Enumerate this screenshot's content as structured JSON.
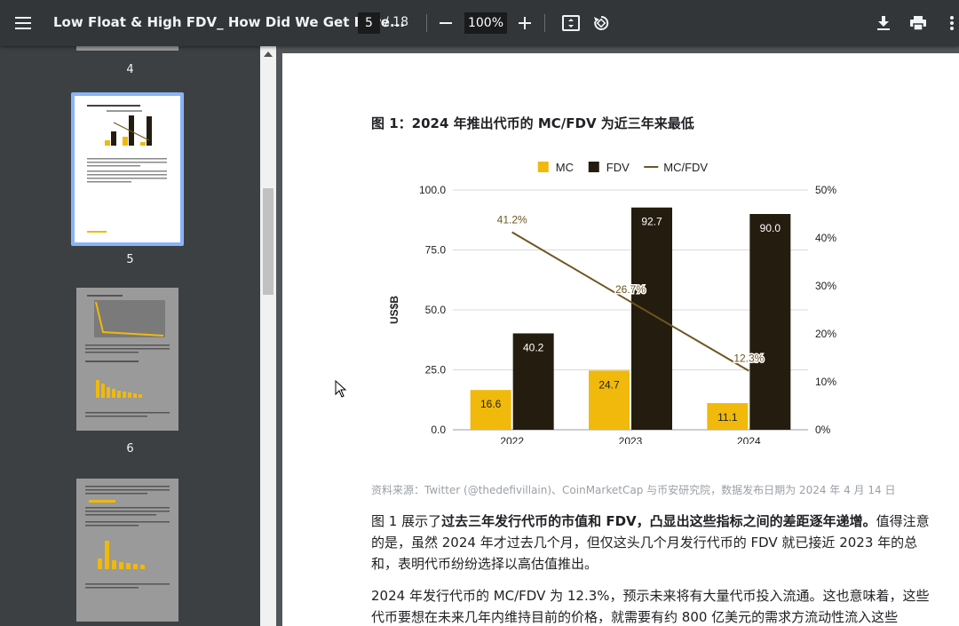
{
  "toolbar": {
    "title": "Low Float & High FDV_ How Did We Get Here...",
    "page_current": "5",
    "page_total": "/ 18",
    "zoom": "100%"
  },
  "sidebar": {
    "labels": [
      "4",
      "5",
      "6"
    ]
  },
  "figure": {
    "title": "图 1：2024 年推出代币的 MC/FDV 为近三年来最低",
    "source": "资料来源：Twitter (@thedefivillain)、CoinMarketCap 与币安研究院，数据发布日期为 2024 年 4 月 14 日"
  },
  "chart_data": {
    "type": "bar",
    "categories": [
      "2022",
      "2023",
      "2024"
    ],
    "series": [
      {
        "name": "MC",
        "values": [
          16.6,
          24.7,
          11.1
        ],
        "color": "#f0b90b",
        "kind": "bar"
      },
      {
        "name": "FDV",
        "values": [
          40.2,
          92.7,
          90.0
        ],
        "color": "#241d0f",
        "kind": "bar"
      },
      {
        "name": "MC/FDV",
        "values": [
          41.2,
          26.7,
          12.3
        ],
        "color": "#6e5520",
        "kind": "line",
        "axis": "right"
      }
    ],
    "value_labels": {
      "MC": [
        "16.6",
        "24.7",
        "11.1"
      ],
      "FDV": [
        "40.2",
        "92.7",
        "90.0"
      ],
      "MC/FDV": [
        "41.2%",
        "26.7%",
        "12.3%"
      ]
    },
    "ylabel": "US$B",
    "ylim": [
      0,
      100
    ],
    "y_ticks": [
      "0.0",
      "25.0",
      "50.0",
      "75.0",
      "100.0"
    ],
    "y2lim": [
      0,
      50
    ],
    "y2_ticks": [
      "0%",
      "10%",
      "20%",
      "30%",
      "40%",
      "50%"
    ],
    "legend": "top-center",
    "grid": true
  },
  "body": {
    "p1_a": "图 1 展示了",
    "p1_b": "过去三年发行代币的市值和 FDV，凸显出这些指标之间的差距逐年递增。",
    "p1_c": "值得注意的是，虽然 2024 年才过去几个月，但仅这头几个月发行代币的 FDV 就已接近 2023 年的总和，表明代币纷纷选择以高估值推出。",
    "p2": "2024 年发行代币的 MC/FDV 为 12.3%，预示未来将有大量代币投入流通。这也意味着，这些代币要想在未来几年内维持目前的价格，就需要有约 800 亿美元的需求方流动性流入这些"
  }
}
